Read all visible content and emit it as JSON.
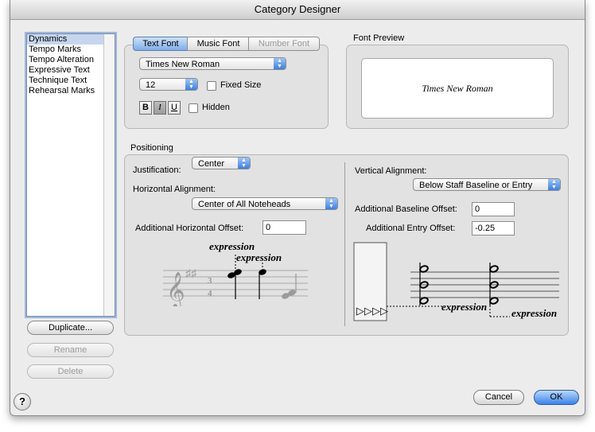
{
  "window": {
    "title": "Category Designer"
  },
  "categories": [
    "Dynamics",
    "Tempo Marks",
    "Tempo Alteration",
    "Expressive Text",
    "Technique Text",
    "Rehearsal Marks"
  ],
  "selected_category": "Dynamics",
  "list_buttons": {
    "duplicate": "Duplicate...",
    "rename": "Rename",
    "delete": "Delete"
  },
  "font_tabs": {
    "text": "Text Font",
    "music": "Music Font",
    "number": "Number Font",
    "active": "Text Font"
  },
  "font": {
    "family": "Times New Roman",
    "size": "12",
    "fixed_size_label": "Fixed Size",
    "hidden_label": "Hidden",
    "style_bold": "B",
    "style_italic": "I",
    "style_underline": "U",
    "italic_active": true
  },
  "preview": {
    "label": "Font Preview",
    "sample": "Times New Roman"
  },
  "positioning": {
    "label": "Positioning",
    "justification_label": "Justification:",
    "justification_value": "Center",
    "horizontal_alignment_label": "Horizontal Alignment:",
    "horizontal_alignment_value": "Center of All Noteheads",
    "h_offset_label": "Additional Horizontal Offset:",
    "h_offset_value": "0",
    "vertical_alignment_label": "Vertical Alignment:",
    "vertical_alignment_value": "Below Staff Baseline or Entry",
    "baseline_offset_label": "Additional Baseline Offset:",
    "baseline_offset_value": "0",
    "entry_offset_label": "Additional Entry Offset:",
    "entry_offset_value": "-0.25",
    "example_word": "expression"
  },
  "dialog_buttons": {
    "help": "?",
    "cancel": "Cancel",
    "ok": "OK"
  }
}
